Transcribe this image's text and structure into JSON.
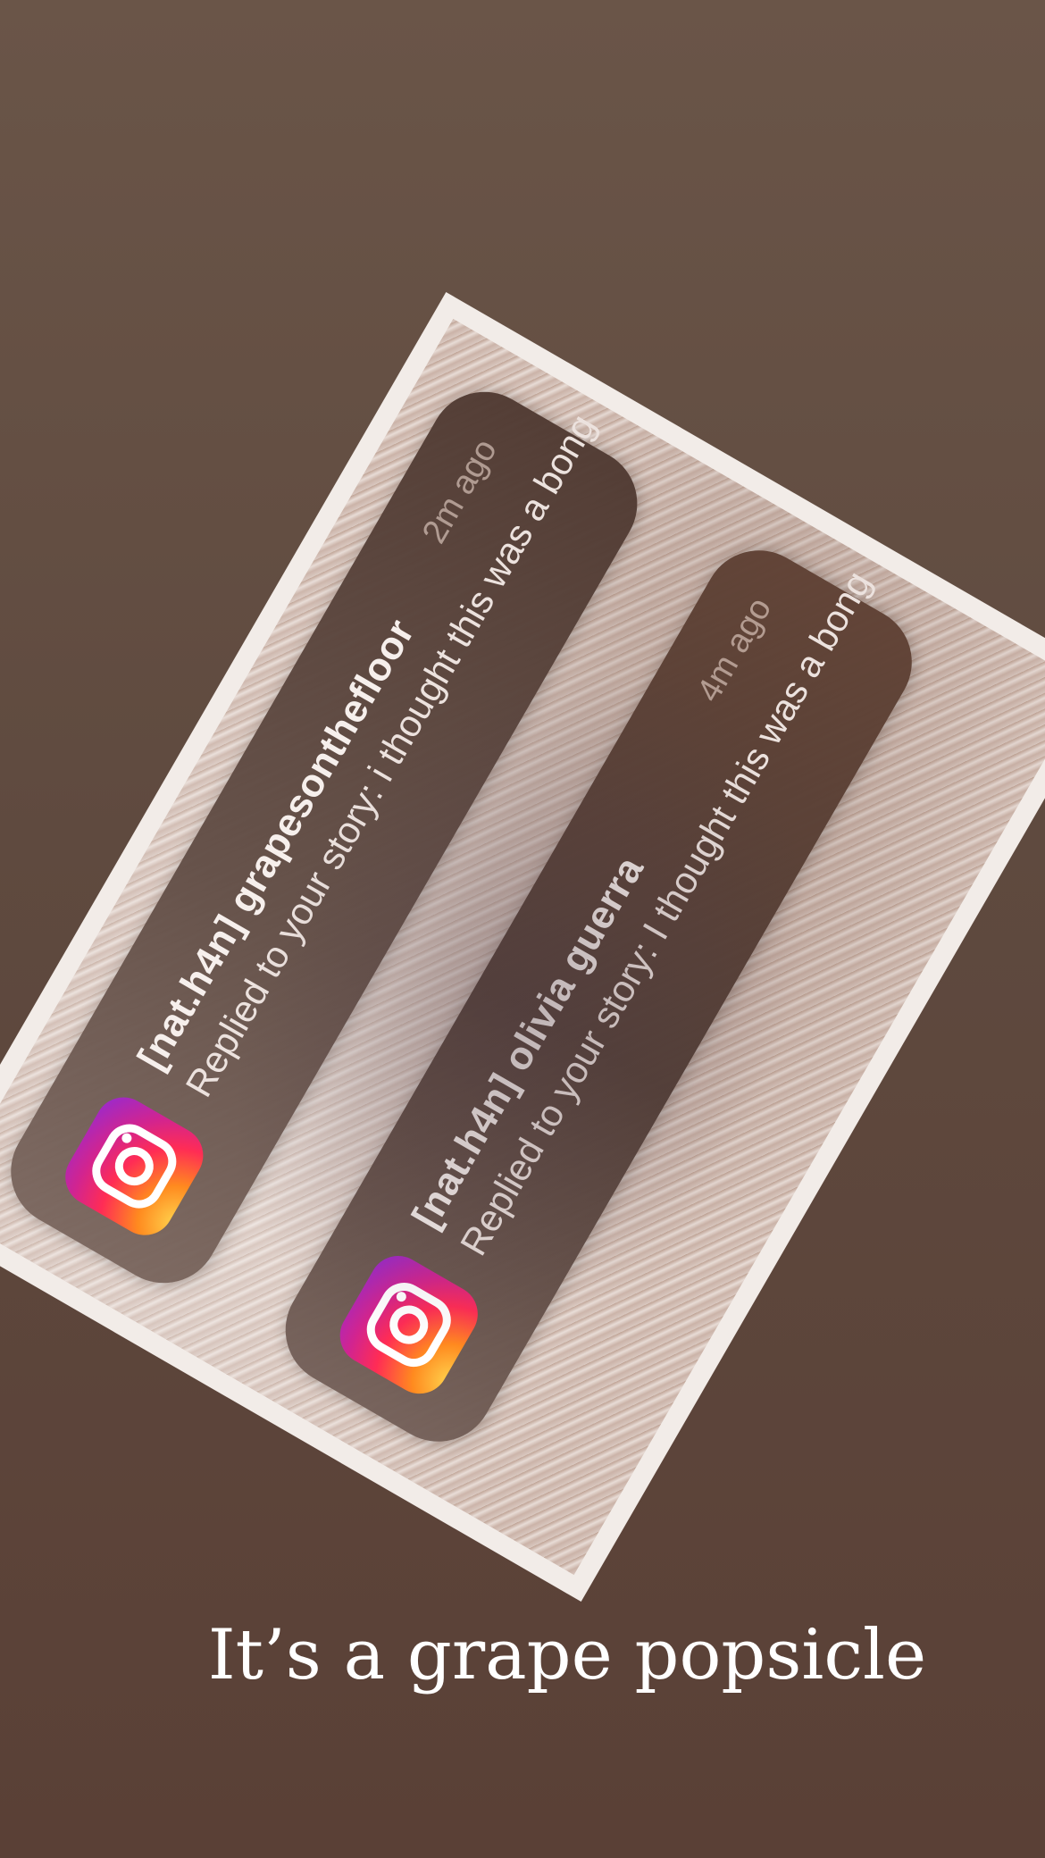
{
  "notifications": [
    {
      "app_icon": "instagram-icon",
      "title": "[nat.h4n] grapesonthefloor",
      "body": "Replied to your story: i thought this was a bong",
      "time": "2m ago"
    },
    {
      "app_icon": "instagram-icon",
      "title": "[nat.h4n] olivia guerra",
      "body": "Replied to your story: I thought this was a bong",
      "time": "4m ago"
    }
  ],
  "caption": "It’s a grape popsicle",
  "colors": {
    "background": "#5f4a3f",
    "notification_bg": "#6b5248",
    "caption_text": "#ffffff"
  }
}
